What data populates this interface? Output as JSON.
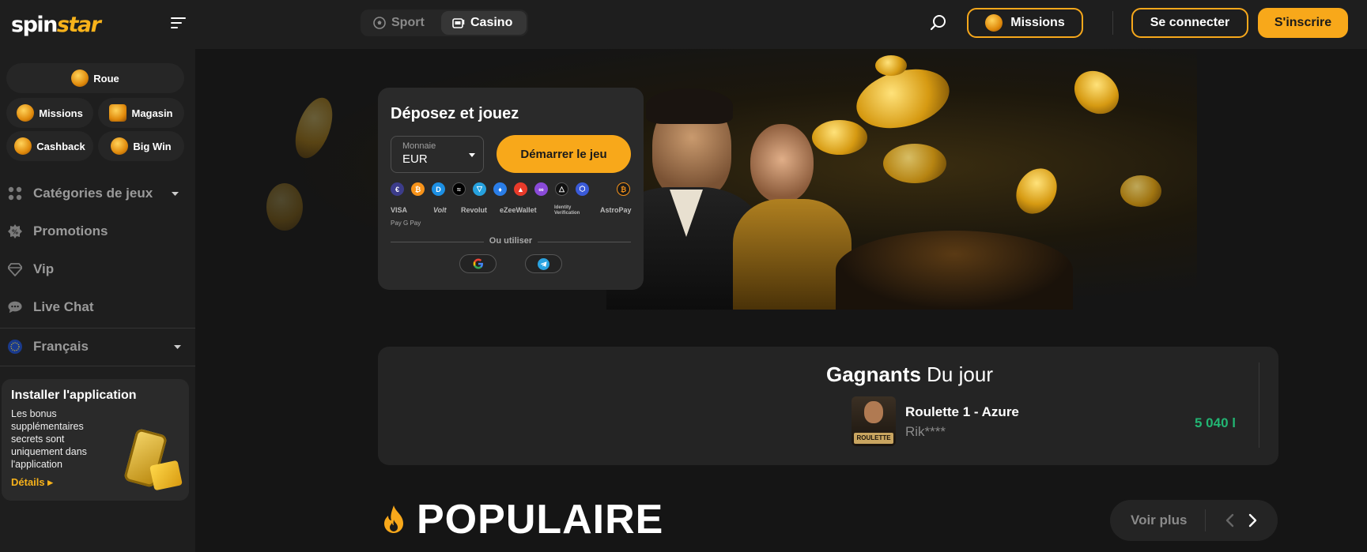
{
  "header": {
    "logo_part1": "spin",
    "logo_part2": "star",
    "modes": [
      {
        "label": "Sport"
      },
      {
        "label": "Casino"
      }
    ],
    "missions_label": "Missions",
    "login_label": "Se connecter",
    "signup_label": "S'inscrire"
  },
  "sidebar": {
    "pills": [
      {
        "label": "Roue"
      },
      {
        "label": "Missions"
      },
      {
        "label": "Magasin"
      },
      {
        "label": "Cashback"
      },
      {
        "label": "Big Win"
      }
    ],
    "nav": [
      {
        "label": "Catégories de jeux"
      },
      {
        "label": "Promotions"
      },
      {
        "label": "Vip"
      },
      {
        "label": "Live Chat"
      },
      {
        "label": "Français"
      }
    ],
    "install": {
      "title": "Installer l'application",
      "text": "Les bonus supplémentaires secrets sont uniquement dans l'application",
      "details": "Détails ▸"
    }
  },
  "deposit": {
    "title": "Déposez et jouez",
    "currency_label": "Monnaie",
    "currency_value": "EUR",
    "start_button": "Démarrer le jeu",
    "payments": [
      "VISA",
      "Volt",
      "Revolut",
      "eZeeWallet",
      "Identity Verification",
      "AstroPay"
    ],
    "payments_row2": " Pay G Pay",
    "or_text": "Ou utiliser"
  },
  "winners": {
    "title_bold": "Gagnants",
    "title_thin": "Du jour",
    "game": "Roulette 1 - Azure",
    "user": "Rik****",
    "amount": "5 040 l",
    "thumb_tag": "ROULETTE"
  },
  "popular": {
    "title": "POPULAIRE",
    "see_more": "Voir plus"
  },
  "colors": {
    "accent": "#f8a81a",
    "win_green": "#22b573",
    "panel": "#2a2a2a"
  }
}
